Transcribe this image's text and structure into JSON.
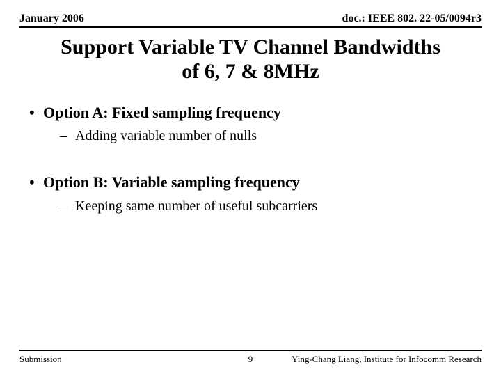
{
  "header": {
    "date": "January 2006",
    "docref": "doc.: IEEE 802. 22-05/0094r3"
  },
  "title": {
    "line1": "Support Variable TV Channel Bandwidths",
    "line2": "of 6, 7 & 8MHz"
  },
  "bullets": {
    "optA": {
      "dot": "•",
      "text": "Option A: Fixed sampling frequency"
    },
    "optA_sub": {
      "dash": "–",
      "text": "Adding variable number of nulls"
    },
    "optB": {
      "dot": "•",
      "text": "Option B: Variable sampling frequency"
    },
    "optB_sub": {
      "dash": "–",
      "text": "Keeping same number of useful subcarriers"
    }
  },
  "footer": {
    "left": "Submission",
    "page": "9",
    "right": "Ying-Chang Liang, Institute for Infocomm Research"
  }
}
